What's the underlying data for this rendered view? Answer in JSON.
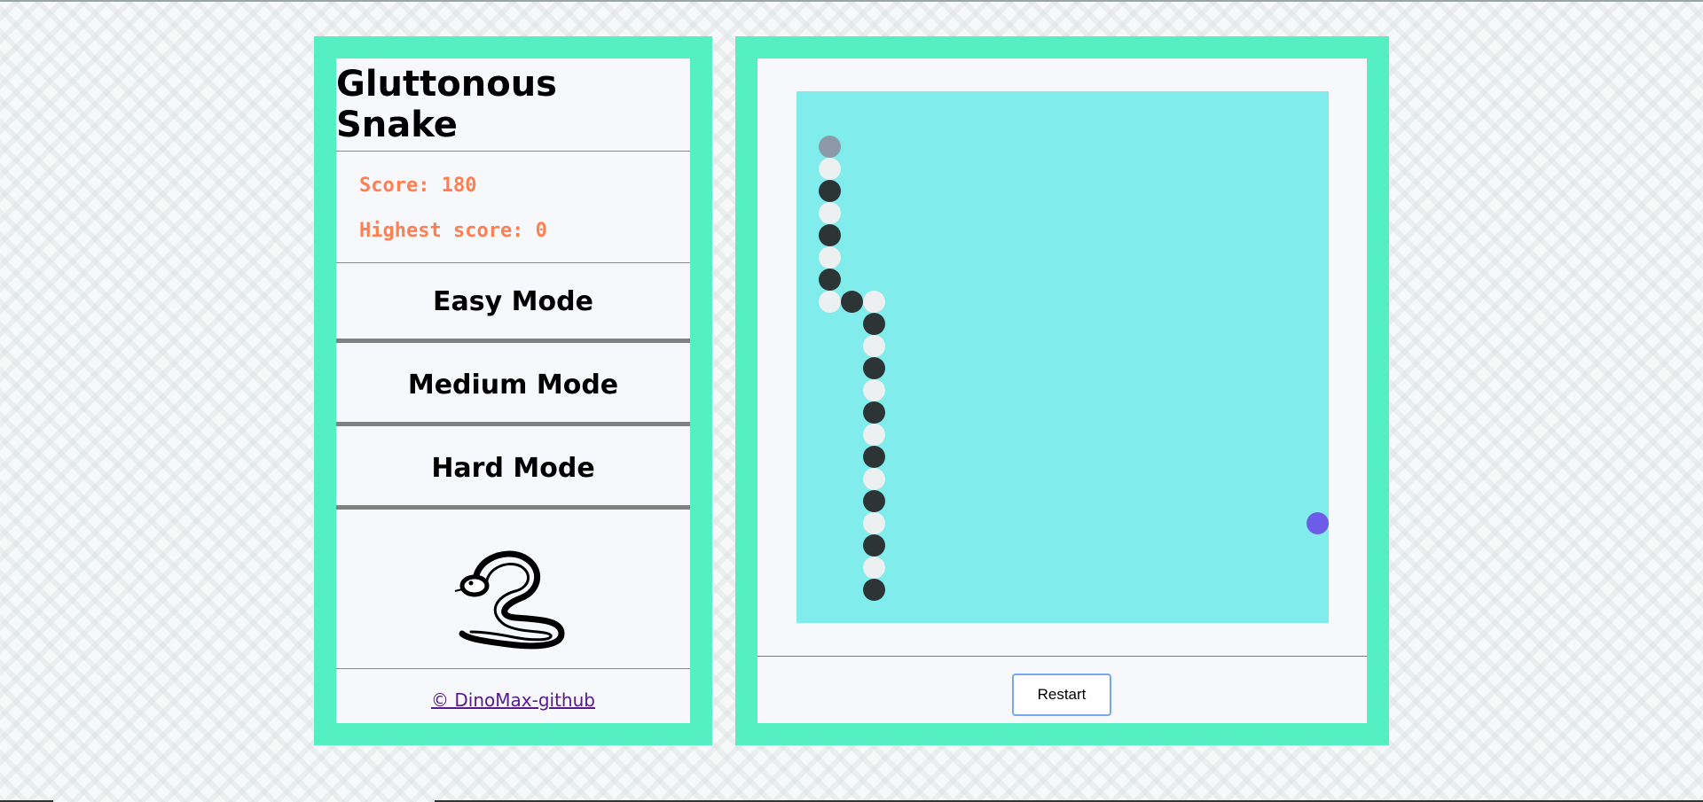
{
  "app": {
    "title": "Gluttonous Snake"
  },
  "scoreboard": {
    "score_text": "Score: 180",
    "highest_text": "Highest score: 0"
  },
  "modes": {
    "easy": "Easy Mode",
    "medium": "Medium Mode",
    "hard": "Hard Mode"
  },
  "footer": {
    "credit": "© DinoMax-github"
  },
  "game": {
    "restart_label": "Restart",
    "grid": {
      "cols": 24,
      "rows": 24
    },
    "snake": [
      [
        1,
        2
      ],
      [
        1,
        3
      ],
      [
        1,
        4
      ],
      [
        1,
        5
      ],
      [
        1,
        6
      ],
      [
        1,
        7
      ],
      [
        1,
        8
      ],
      [
        1,
        9
      ],
      [
        2,
        9
      ],
      [
        3,
        9
      ],
      [
        3,
        10
      ],
      [
        3,
        11
      ],
      [
        3,
        12
      ],
      [
        3,
        13
      ],
      [
        3,
        14
      ],
      [
        3,
        15
      ],
      [
        3,
        16
      ],
      [
        3,
        17
      ],
      [
        3,
        18
      ],
      [
        3,
        19
      ],
      [
        3,
        20
      ],
      [
        3,
        21
      ],
      [
        3,
        22
      ]
    ],
    "food": [
      23,
      19
    ],
    "colors": {
      "board": "#81ecec",
      "head": "#8e99a8",
      "body_dark": "#2d3436",
      "body_light": "#ecf0f1",
      "food": "#6c5ce7",
      "panel_border": "#55efc4",
      "score_text": "#ff7f50"
    }
  },
  "icons": {
    "logo": "snake-icon"
  }
}
